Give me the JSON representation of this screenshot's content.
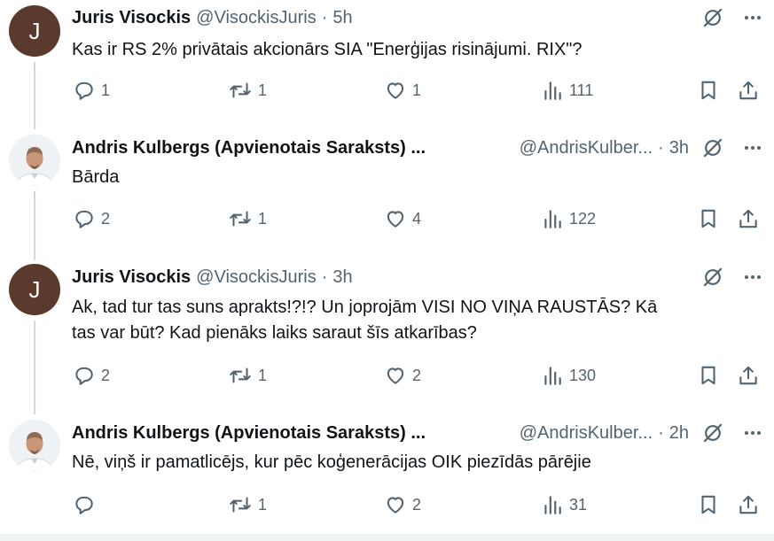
{
  "tweets": [
    {
      "name": "Juris Visockis",
      "handle": "@VisockisJuris",
      "time": "5h",
      "text": "Kas ir RS 2% privātais akcionārs SIA \"Enerģijas risinājumi. RIX\"?",
      "avatar_letter": "J",
      "replies": "1",
      "reposts": "1",
      "likes": "1",
      "views": "111"
    },
    {
      "name": "Andris Kulbergs (Apvienotais Saraksts) ...",
      "handle": "@AndrisKulber...",
      "time": "3h",
      "text": "Bārda",
      "replies": "2",
      "reposts": "1",
      "likes": "4",
      "views": "122"
    },
    {
      "name": "Juris Visockis",
      "handle": "@VisockisJuris",
      "time": "3h",
      "text_line1": "Ak, tad tur tas suns aprakts!?!? Un joprojām VISI NO VIŅA RAUSTĀS? Kā",
      "text_line2": "tas var būt? Kad pienāks laiks saraut šīs atkarības?",
      "avatar_letter": "J",
      "replies": "2",
      "reposts": "1",
      "likes": "2",
      "views": "130"
    },
    {
      "name": "Andris Kulbergs (Apvienotais Saraksts) ...",
      "handle": "@AndrisKulber...",
      "time": "2h",
      "text": "Nē, viņš ir pamatlicējs, kur pēc koģenerācijas OIK piezīdās pārējie",
      "replies": "",
      "reposts": "1",
      "likes": "2",
      "views": "31"
    }
  ],
  "separator": "·",
  "colors": {
    "text": "#0f1419",
    "muted": "#536471",
    "thread_line": "#cfd9de",
    "avatar_bg": "#5b3a2e"
  }
}
